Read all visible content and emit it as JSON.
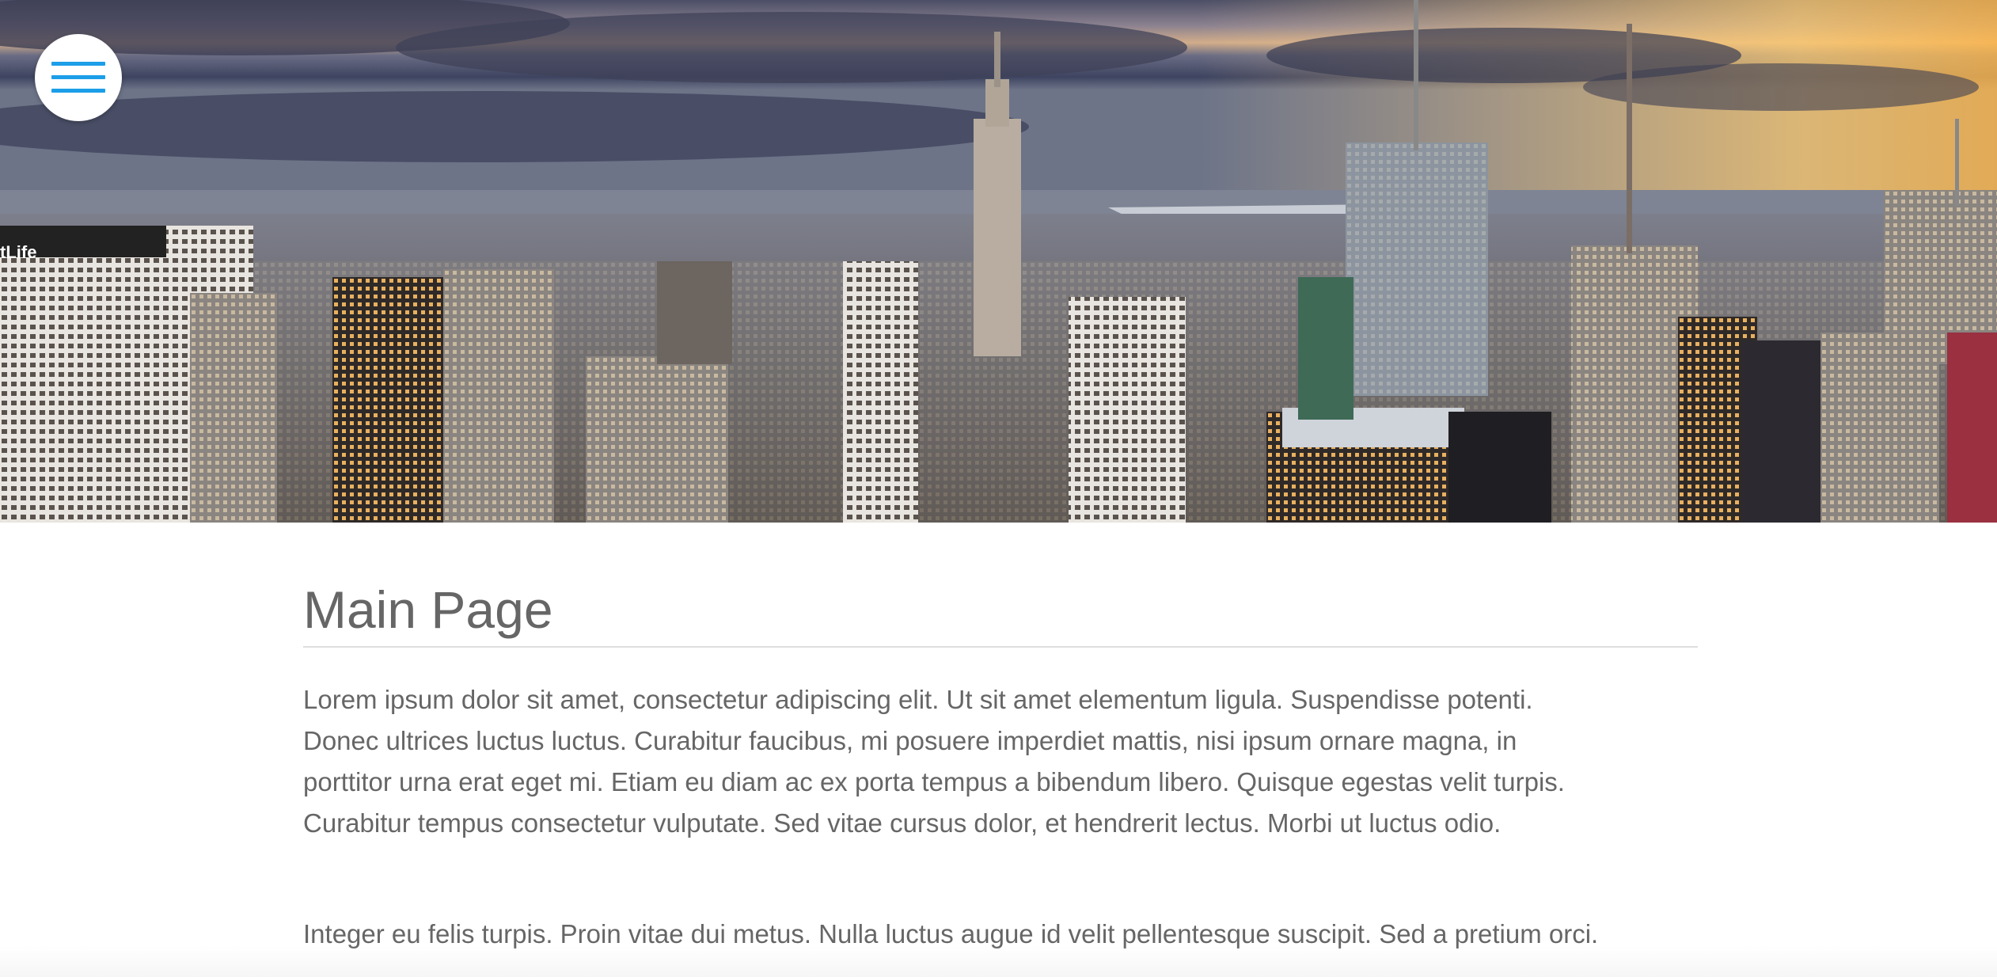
{
  "menu": {
    "icon": "hamburger-menu-icon",
    "accent_color": "#1c9ee8"
  },
  "hero": {
    "sign_text": "tLife"
  },
  "main": {
    "title": "Main Page",
    "paragraphs": [
      "Lorem ipsum dolor sit amet, consectetur adipiscing elit. Ut sit amet elementum ligula. Suspendisse potenti.\nDonec ultrices luctus luctus. Curabitur faucibus, mi posuere imperdiet mattis, nisi ipsum ornare magna, in\nporttitor urna erat eget mi. Etiam eu diam ac ex porta tempus a bibendum libero. Quisque egestas velit turpis.\nCurabitur tempus consectetur vulputate. Sed vitae cursus dolor, et hendrerit lectus. Morbi ut luctus odio.",
      "Integer eu felis turpis. Proin vitae dui metus. Nulla luctus augue id velit pellentesque suscipit. Sed a pretium orci."
    ]
  },
  "colors": {
    "text": "#666666",
    "rule": "#dedede"
  }
}
